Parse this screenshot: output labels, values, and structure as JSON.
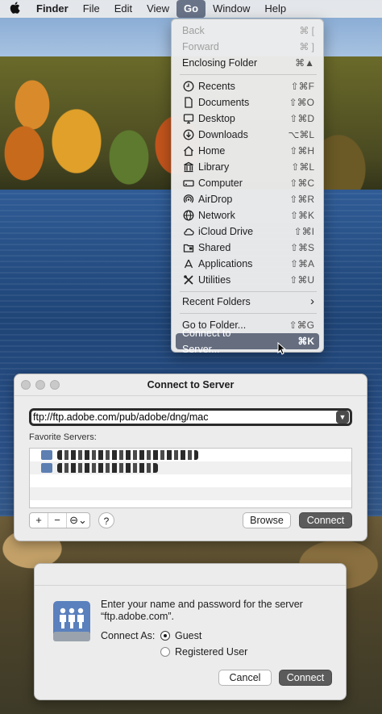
{
  "menubar": {
    "apple_icon": "apple-icon",
    "items": [
      "Finder",
      "File",
      "Edit",
      "View",
      "Go",
      "Window",
      "Help"
    ]
  },
  "go_menu": {
    "back": {
      "label": "Back",
      "shortcut": "⌘ ["
    },
    "forward": {
      "label": "Forward",
      "shortcut": "⌘ ]"
    },
    "enclosing": {
      "label": "Enclosing Folder",
      "shortcut": "⌘▲"
    },
    "items": [
      {
        "label": "Recents",
        "shortcut": "⇧⌘F",
        "icon": "clock-icon"
      },
      {
        "label": "Documents",
        "shortcut": "⇧⌘O",
        "icon": "document-icon"
      },
      {
        "label": "Desktop",
        "shortcut": "⇧⌘D",
        "icon": "desktop-icon"
      },
      {
        "label": "Downloads",
        "shortcut": "⌥⌘L",
        "icon": "download-icon"
      },
      {
        "label": "Home",
        "shortcut": "⇧⌘H",
        "icon": "home-icon"
      },
      {
        "label": "Library",
        "shortcut": "⇧⌘L",
        "icon": "library-icon"
      },
      {
        "label": "Computer",
        "shortcut": "⇧⌘C",
        "icon": "computer-icon"
      },
      {
        "label": "AirDrop",
        "shortcut": "⇧⌘R",
        "icon": "airdrop-icon"
      },
      {
        "label": "Network",
        "shortcut": "⇧⌘K",
        "icon": "globe-icon"
      },
      {
        "label": "iCloud Drive",
        "shortcut": "⇧⌘I",
        "icon": "cloud-icon"
      },
      {
        "label": "Shared",
        "shortcut": "⇧⌘S",
        "icon": "shared-folder-icon"
      },
      {
        "label": "Applications",
        "shortcut": "⇧⌘A",
        "icon": "applications-icon"
      },
      {
        "label": "Utilities",
        "shortcut": "⇧⌘U",
        "icon": "utilities-icon"
      }
    ],
    "recent_folders": {
      "label": "Recent Folders",
      "submenu_arrow": "›"
    },
    "go_to_folder": {
      "label": "Go to Folder...",
      "shortcut": "⇧⌘G"
    },
    "connect_to_server": {
      "label": "Connect to Server...",
      "shortcut": "⌘K"
    }
  },
  "connect_window": {
    "title": "Connect to Server",
    "address": "ftp://ftp.adobe.com/pub/adobe/dng/mac",
    "favorites_label": "Favorite Servers:",
    "add": "+",
    "remove": "−",
    "more": "⊖⌄",
    "help": "?",
    "browse": "Browse",
    "connect": "Connect"
  },
  "auth_sheet": {
    "message": "Enter your name and password for the server “ftp.adobe.com”.",
    "connect_as": "Connect As:",
    "guest": "Guest",
    "registered": "Registered User",
    "selected": "Guest",
    "cancel": "Cancel",
    "connect": "Connect"
  }
}
